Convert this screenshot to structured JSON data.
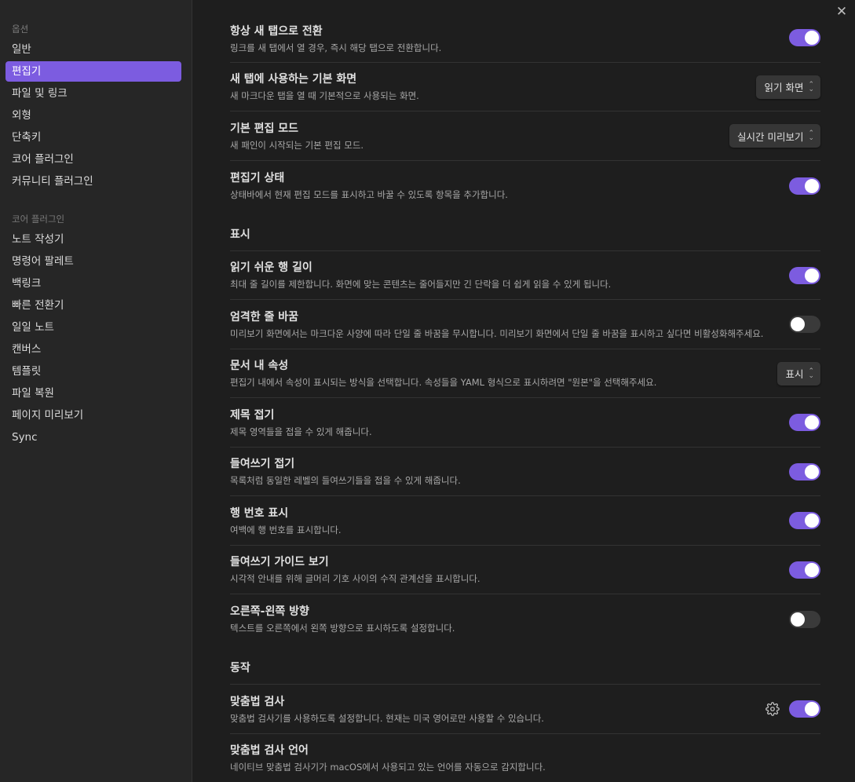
{
  "sidebar": {
    "options_title": "옵션",
    "options_items": [
      {
        "label": "일반"
      },
      {
        "label": "편집기"
      },
      {
        "label": "파일 및 링크"
      },
      {
        "label": "외형"
      },
      {
        "label": "단축키"
      },
      {
        "label": "코어 플러그인"
      },
      {
        "label": "커뮤니티 플러그인"
      }
    ],
    "plugins_title": "코어 플러그인",
    "plugin_items": [
      {
        "label": "노트 작성기"
      },
      {
        "label": "명령어 팔레트"
      },
      {
        "label": "백링크"
      },
      {
        "label": "빠른 전환기"
      },
      {
        "label": "일일 노트"
      },
      {
        "label": "캔버스"
      },
      {
        "label": "템플릿"
      },
      {
        "label": "파일 복원"
      },
      {
        "label": "페이지 미리보기"
      },
      {
        "label": "Sync"
      }
    ]
  },
  "close_label": "✕",
  "settings": {
    "always_new_tab": {
      "name": "항상 새 탭으로 전환",
      "desc": "링크를 새 탭에서 열 경우, 즉시 해당 탭으로 전환합니다.",
      "state": "on"
    },
    "default_view": {
      "name": "새 탭에 사용하는 기본 화면",
      "desc": "새 마크다운 탭을 열 때 기본적으로 사용되는 화면.",
      "value": "읽기 화면"
    },
    "default_edit_mode": {
      "name": "기본 편집 모드",
      "desc": "새 패인이 시작되는 기본 편집 모드.",
      "value": "실시간 미리보기"
    },
    "editor_status": {
      "name": "편집기 상태",
      "desc": "상태바에서 현재 편집 모드를 표시하고 바꿀 수 있도록 항목을 추가합니다.",
      "state": "on"
    },
    "display_heading": "표시",
    "readable_line": {
      "name": "읽기 쉬운 행 길이",
      "desc": "최대 줄 길이를 제한합니다. 화면에 맞는 콘텐츠는 줄어들지만 긴 단락을 더 쉽게 읽을 수 있게 됩니다.",
      "state": "on"
    },
    "strict_line_breaks": {
      "name": "엄격한 줄 바꿈",
      "desc": "미리보기 화면에서는 마크다운 사양에 따라 단일 줄 바꿈을 무시합니다. 미리보기 화면에서 단일 줄 바꿈을 표시하고 싶다면 비활성화해주세요.",
      "state": "off"
    },
    "properties": {
      "name": "문서 내 속성",
      "desc": "편집기 내에서 속성이 표시되는 방식을 선택합니다. 속성들을 YAML 형식으로 표시하려면 \"원본\"을 선택해주세요.",
      "value": "표시"
    },
    "fold_heading": {
      "name": "제목 접기",
      "desc": "제목 영역들을 접을 수 있게 해줍니다.",
      "state": "on"
    },
    "fold_indent": {
      "name": "들여쓰기 접기",
      "desc": "목록처럼 동일한 레벨의 들여쓰기들을 접을 수 있게 해줍니다.",
      "state": "on"
    },
    "line_numbers": {
      "name": "행 번호 표시",
      "desc": "여백에 행 번호를 표시합니다.",
      "state": "on"
    },
    "indent_guides": {
      "name": "들여쓰기 가이드 보기",
      "desc": "시각적 안내를 위해 글머리 기호 사이의 수직 관계선을 표시합니다.",
      "state": "on"
    },
    "rtl": {
      "name": "오른쪽-왼쪽 방향",
      "desc": "텍스트를 오른쪽에서 왼쪽 방향으로 표시하도록 설정합니다.",
      "state": "off"
    },
    "behavior_heading": "동작",
    "spellcheck": {
      "name": "맞춤법 검사",
      "desc": "맞춤법 검사기를 사용하도록 설정합니다. 현재는 미국 영어로만 사용할 수 있습니다.",
      "state": "on"
    },
    "spellcheck_lang": {
      "name": "맞춤법 검사 언어",
      "desc": "네이티브 맞춤법 검사기가 macOS에서 사용되고 있는 언어를 자동으로 감지합니다."
    }
  },
  "colors": {
    "accent": "#7c5ce0",
    "background": "#1e1e1e",
    "sidebar": "#262626"
  }
}
